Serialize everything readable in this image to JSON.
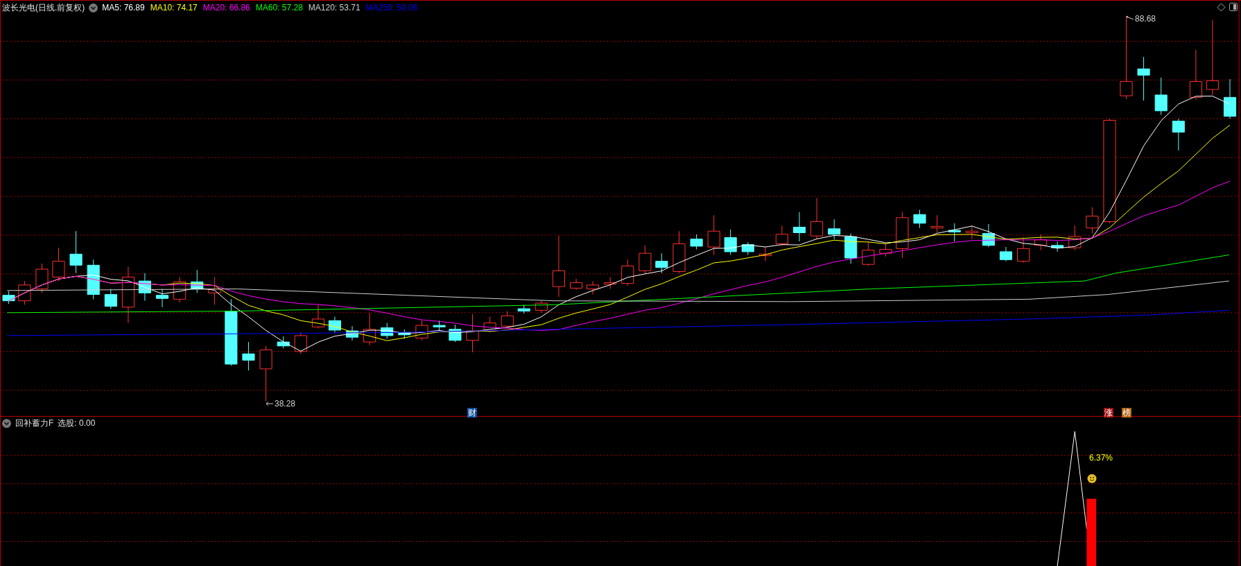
{
  "main_chart": {
    "title": "波长光电(日线.前复权)",
    "moving_averages": [
      {
        "label": "MA5: 76.89",
        "color": "#ffffff"
      },
      {
        "label": "MA10: 74.17",
        "color": "#ffff00"
      },
      {
        "label": "MA20: 66.86",
        "color": "#ff00ff"
      },
      {
        "label": "MA60: 57.28",
        "color": "#00ff00"
      },
      {
        "label": "MA120: 53.71",
        "color": "#d0d0d0"
      },
      {
        "label": "MA250: 50.06",
        "color": "#0000ff"
      }
    ],
    "high_label": "88.68",
    "low_label": "38.28",
    "event_badges": [
      {
        "text": "财",
        "color": "#1050a0"
      },
      {
        "text": "涨",
        "color": "#a01010"
      },
      {
        "text": "榜",
        "color": "#b06010"
      }
    ]
  },
  "indicator": {
    "name": "回补蓄力F",
    "reading": "选股: 0.00",
    "signal_label": "6.37%"
  }
}
